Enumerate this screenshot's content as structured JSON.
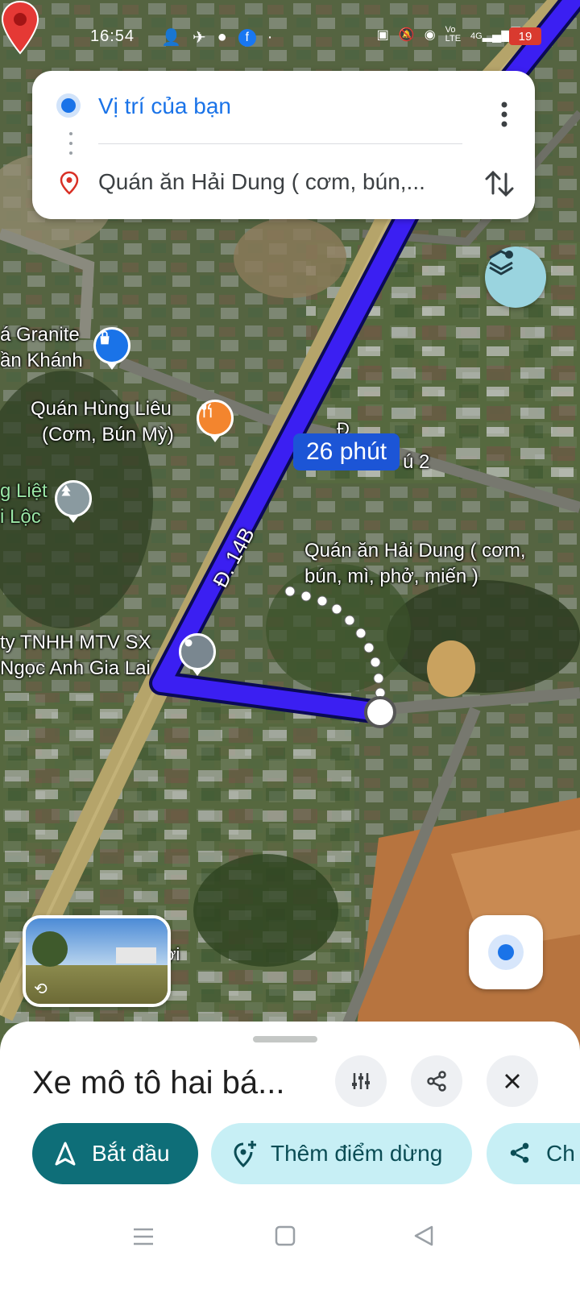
{
  "status_bar": {
    "time": "16:54",
    "network": "4G",
    "battery": "19"
  },
  "directions": {
    "origin": "Vị trí của bạn",
    "destination": "Quán ăn Hải Dung ( cơm, bún,..."
  },
  "map": {
    "labels": {
      "granite_1": "á Granite",
      "granite_2": "ần Khánh",
      "hung_lieu_1": "Quán Hùng Liêu",
      "hung_lieu_2": "(Cơm, Bún Mỳ)",
      "liet_1": "g Liệt",
      "liet_2": "i Lộc",
      "road_d14b": "Đ. 14B",
      "street_2": "ú 2",
      "street_da": "Đ",
      "dest_1": "Quán ăn Hải Dung ( cơm,",
      "dest_2": "bún, mì, phở, miến )",
      "company_1": "ty TNHH MTV SX",
      "company_2": "Ngọc Anh Gia Lai",
      "near_sv": "ợi"
    },
    "route_duration": "26 phút",
    "colors": {
      "route": "#3b1ff2",
      "route_outline": "#0b0a55",
      "pin": "#e53935",
      "poi_orange": "#f3852e",
      "poi_blue": "#1a73e8"
    }
  },
  "bottom_sheet": {
    "mode_title": "Xe mô tô hai bá...",
    "start_label": "Bắt đầu",
    "add_stop_label": "Thêm điểm dừng",
    "share_label_partial": "Ch"
  }
}
